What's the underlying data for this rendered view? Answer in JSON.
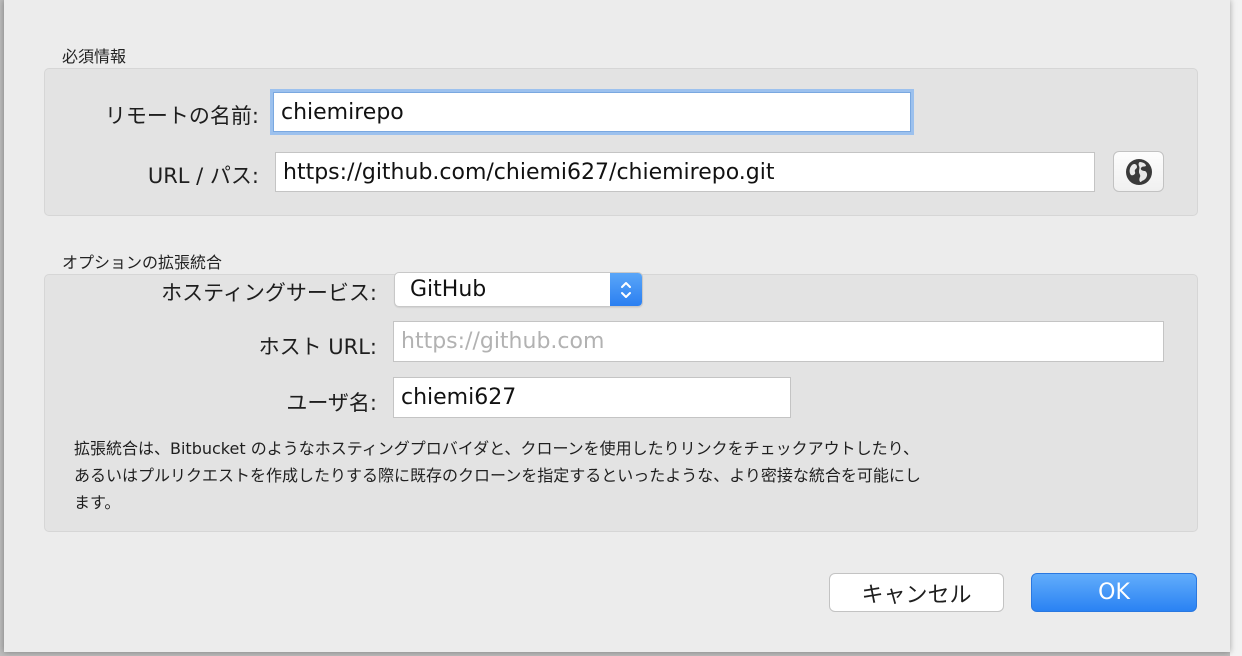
{
  "required": {
    "section_title": "必須情報",
    "remote_name": {
      "label": "リモートの名前:",
      "value": "chiemirepo"
    },
    "url_path": {
      "label": "URL / パス:",
      "value": "https://github.com/chiemi627/chiemirepo.git"
    },
    "globe_icon": "globe-icon"
  },
  "options": {
    "section_title": "オプションの拡張統合",
    "hosting_service": {
      "label": "ホスティングサービス:",
      "selected": "GitHub"
    },
    "host_url": {
      "label": "ホスト URL:",
      "placeholder": "https://github.com"
    },
    "username": {
      "label": "ユーザ名:",
      "value": "chiemi627"
    },
    "description_lines": [
      "拡張統合は、Bitbucket のようなホスティングプロバイダと、クローンを使用したりリンクをチェックアウトしたり、",
      "あるいはプルリクエストを作成したりする際に既存のクローンを指定するといったような、より密接な統合を可能にし",
      "ます。"
    ]
  },
  "buttons": {
    "cancel": "キャンセル",
    "ok": "OK"
  },
  "colors": {
    "focus_ring": "#9cc1ee",
    "accent_blue": "#2a82f3"
  }
}
